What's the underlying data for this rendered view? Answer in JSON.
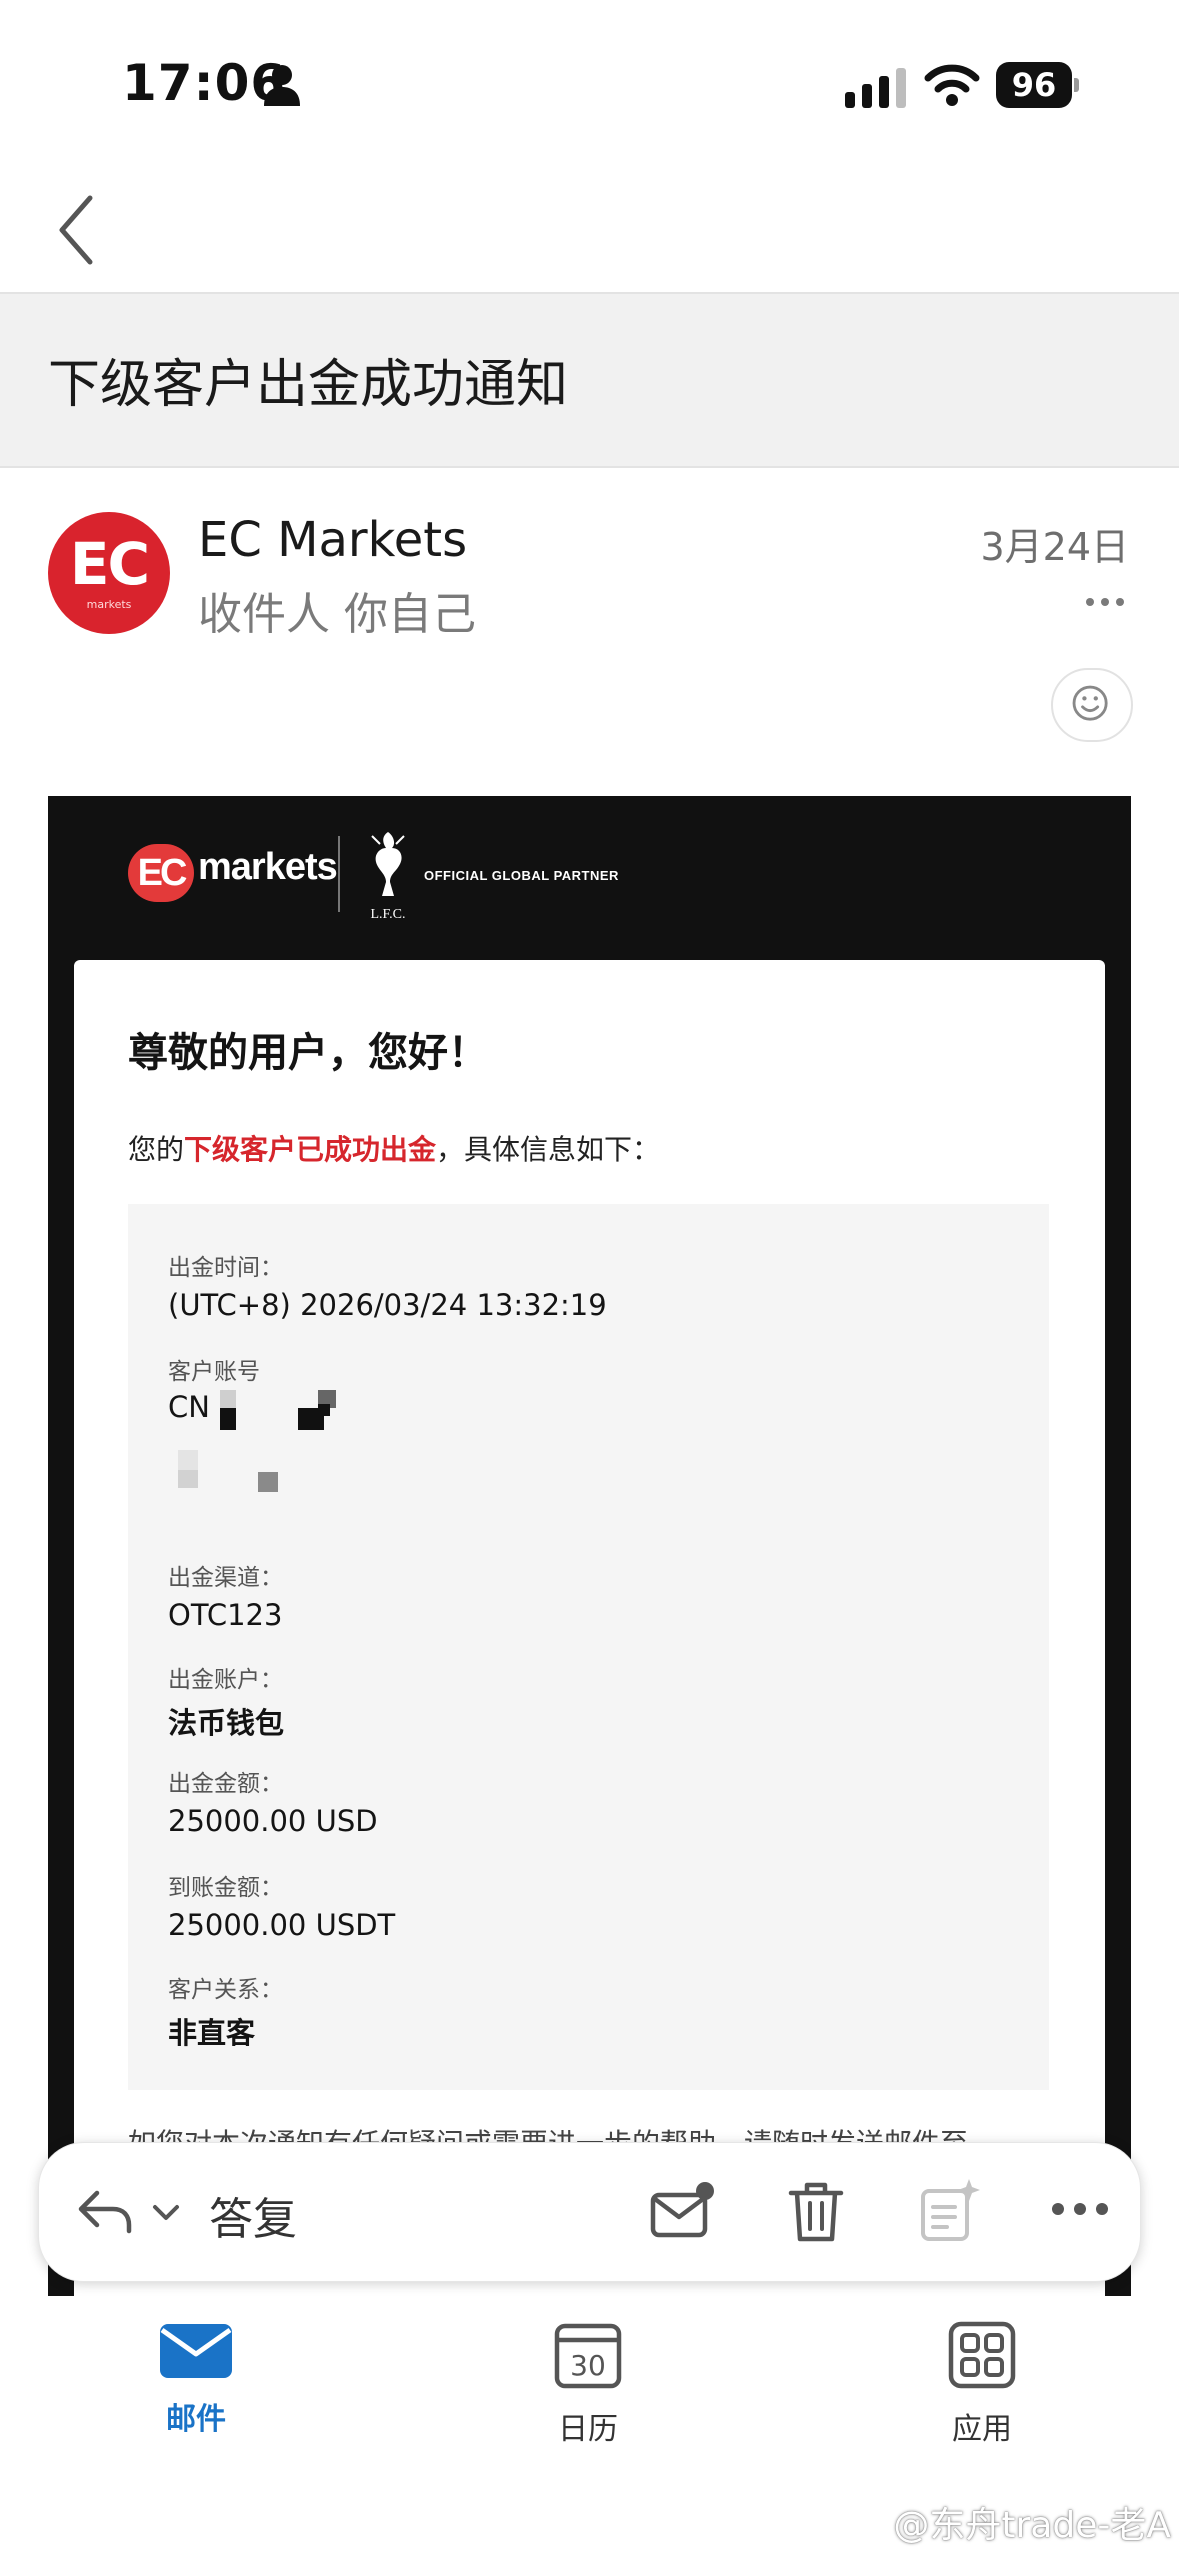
{
  "status_bar": {
    "time": "17:06",
    "battery": "96",
    "icons": [
      "person-icon",
      "signal-icon",
      "wifi-icon",
      "battery-icon"
    ]
  },
  "nav": {
    "back_icon": "chevron-left-icon"
  },
  "subject": "下级客户出金成功通知",
  "sender": {
    "avatar_text": "EC",
    "avatar_subtext": "markets",
    "name": "EC Markets",
    "recipient": "收件人 你自己",
    "date": "3月24日"
  },
  "email": {
    "brand": {
      "logo_mark": "EC",
      "logo_word": "markets",
      "crest_text": "L.F.C.",
      "partner": "OFFICIAL GLOBAL PARTNER"
    },
    "greeting": "尊敬的用户，您好！",
    "intro_prefix": "您的",
    "intro_highlight": "下级客户已成功出金",
    "intro_suffix": "，具体信息如下：",
    "fields": {
      "time_label": "出金时间：",
      "time_value": "(UTC+8) 2026/03/24 13:32:19",
      "account_label": "客户账号",
      "account_value": "CN",
      "channel_label": "出金渠道：",
      "channel_value": "OTC123",
      "wallet_label": "出金账户：",
      "wallet_value": "法币钱包",
      "amount_label": "出金金额：",
      "amount_value": "25000.00 USD",
      "received_label": "到账金额：",
      "received_value": "25000.00 USDT",
      "relation_label": "客户关系：",
      "relation_value": "非直客"
    },
    "truncated_text": "如您对本次通知有任何疑问或需要进一步的帮助，请随时发送邮件至"
  },
  "action_bar": {
    "reply_label": "答复"
  },
  "tabs": [
    {
      "label": "邮件",
      "active": true
    },
    {
      "label": "日历",
      "day": "30",
      "active": false
    },
    {
      "label": "应用",
      "active": false
    }
  ],
  "watermark": "@东舟trade-老A",
  "colors": {
    "brand_red": "#d9232d",
    "highlight_red": "#d6262c",
    "tab_active": "#1a73c7"
  }
}
